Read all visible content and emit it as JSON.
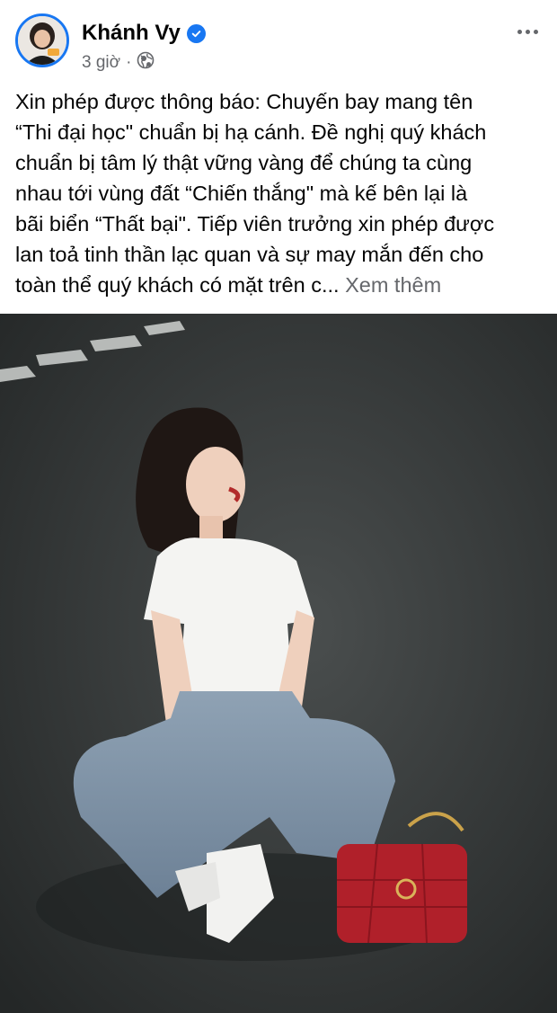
{
  "post": {
    "author": "Khánh Vy",
    "time": "3 giờ",
    "separator": "·",
    "privacy_icon": "globe-icon",
    "verified_icon": "verified-badge-icon",
    "more_icon": "more-options-icon",
    "text_lines": [
      "Xin phép được thông báo: Chuyến bay mang tên",
      "“Thi đại học\" chuẩn bị hạ cánh. Đề nghị quý khách",
      "chuẩn bị tâm lý thật vững vàng để chúng ta cùng",
      "nhau tới vùng đất “Chiến thắng\" mà kế bên lại là",
      "bãi biển “Thất bại\". Tiếp viên trưởng xin phép được",
      "lan toả tinh thần lạc quan và sự may mắn đến cho",
      "toàn thể quý khách có mặt trên c..."
    ],
    "see_more": "Xem thêm"
  },
  "colors": {
    "accent": "#1877f2",
    "secondary_text": "#65676b",
    "primary_text": "#050505"
  }
}
